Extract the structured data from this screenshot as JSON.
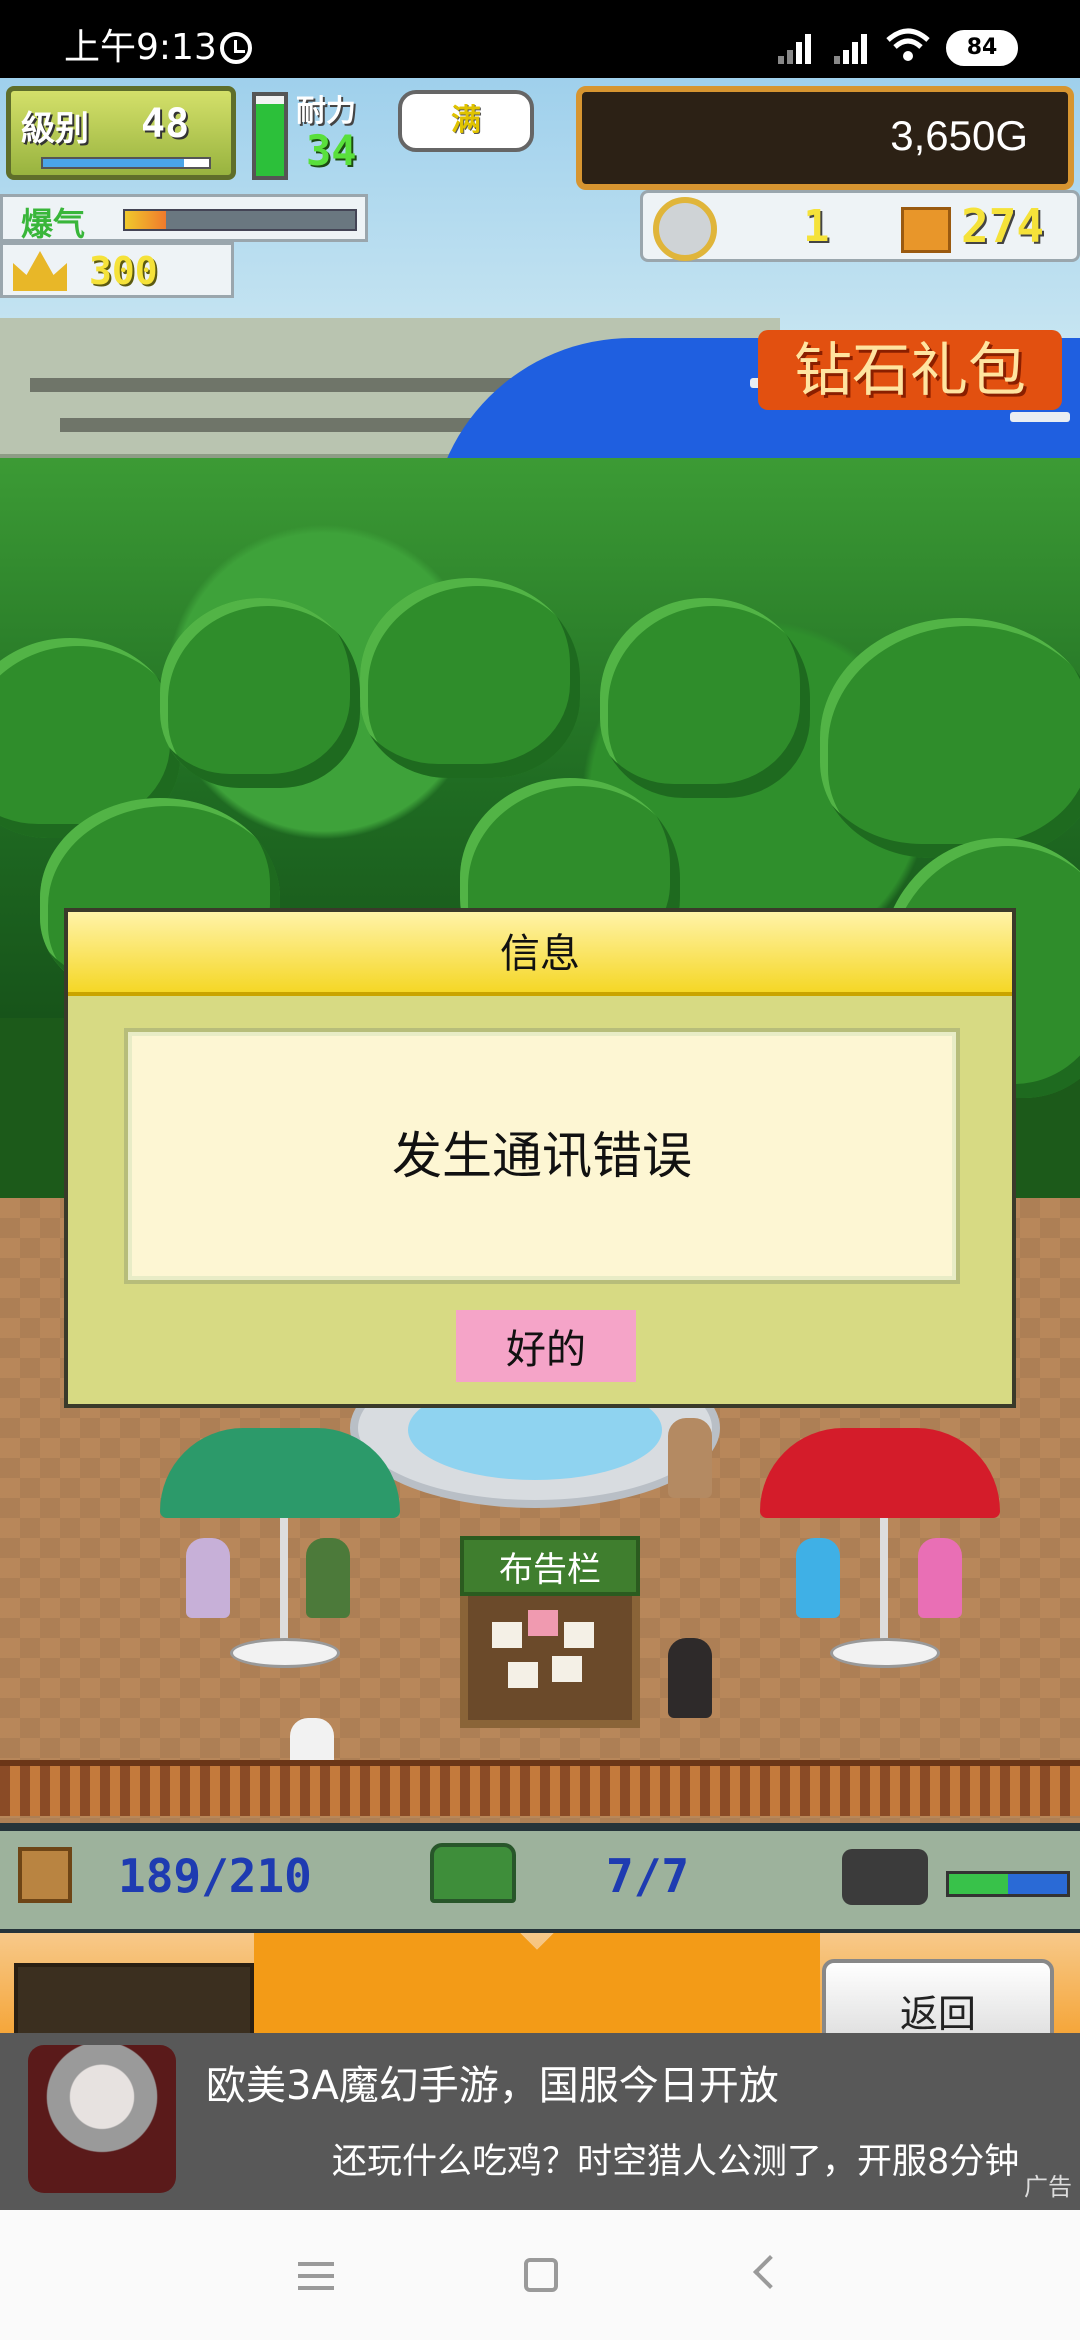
{
  "status_bar": {
    "time": "上午9:13",
    "battery": "84",
    "icons": [
      "alarm-icon",
      "signal-icon",
      "signal-icon",
      "wifi-icon",
      "battery-icon"
    ]
  },
  "hud": {
    "level_label": "級别",
    "level_value": "48",
    "level_progress": 0.85,
    "stamina_label": "耐力",
    "stamina_value": "34",
    "stamina_full_label": "满",
    "stamina_level": 0.9,
    "gold": "3,650G",
    "buzz_label": "爆气",
    "buzz_level": 0.18,
    "crown_value": "300",
    "medal_value": "1",
    "box_value": "274",
    "diamond_pack_label": "钻石礼包"
  },
  "scene": {
    "board_label": "布告栏"
  },
  "dialog": {
    "title": "信息",
    "message": "发生通讯错误",
    "ok_label": "好的"
  },
  "bottom_hud": {
    "storage": "189/210",
    "staff": "7/7",
    "truck_level": 0.5
  },
  "menu": {
    "back_label": "返回"
  },
  "ad": {
    "title": "欧美3A魔幻手游，国服今日开放",
    "subtitle": "还玩什么吃鸡？时空猎人公测了，开服8分钟",
    "tag": "广告"
  },
  "colors": {
    "dialog_header": "#f5d726",
    "dialog_body": "#d7da83",
    "ok_button": "#f5a4c8",
    "gold_frame": "#d79530",
    "sea": "#1f5fe0"
  }
}
